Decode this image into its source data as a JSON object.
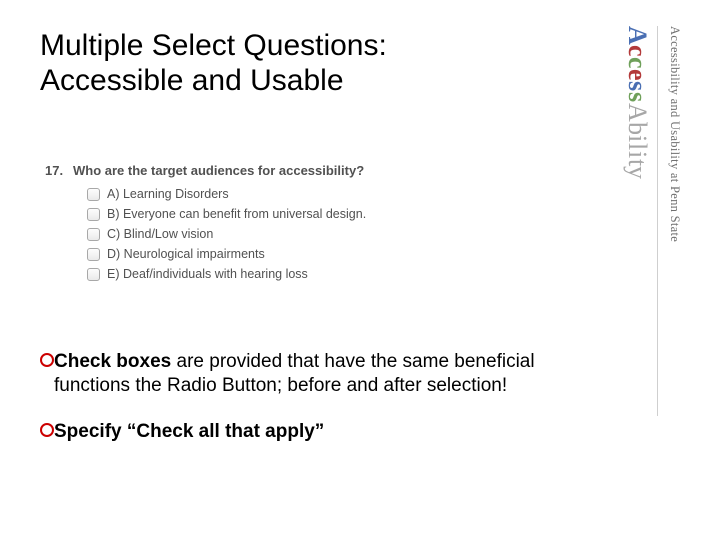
{
  "title_line1": "Multiple Select Questions:",
  "title_line2": "Accessible and Usable",
  "question": {
    "number": "17.",
    "text": "Who are the target audiences for accessibility?",
    "options": [
      "A) Learning Disorders",
      "B) Everyone can benefit from universal design.",
      "C) Blind/Low vision",
      "D) Neurological impairments",
      "E) Deaf/individuals with hearing loss"
    ]
  },
  "bullets": [
    {
      "strong": "Check boxes",
      "rest": " are provided that have the same beneficial functions the Radio Button; before and after selection!"
    },
    {
      "strong": "Specify “Check all that apply”",
      "rest": ""
    }
  ],
  "brand": {
    "letters": [
      "A",
      "c",
      "c",
      "e",
      "s",
      "s",
      "A",
      "b",
      "i",
      "l",
      "i",
      "t",
      "y"
    ]
  },
  "tagline": "Accessibility and Usability at Penn State"
}
